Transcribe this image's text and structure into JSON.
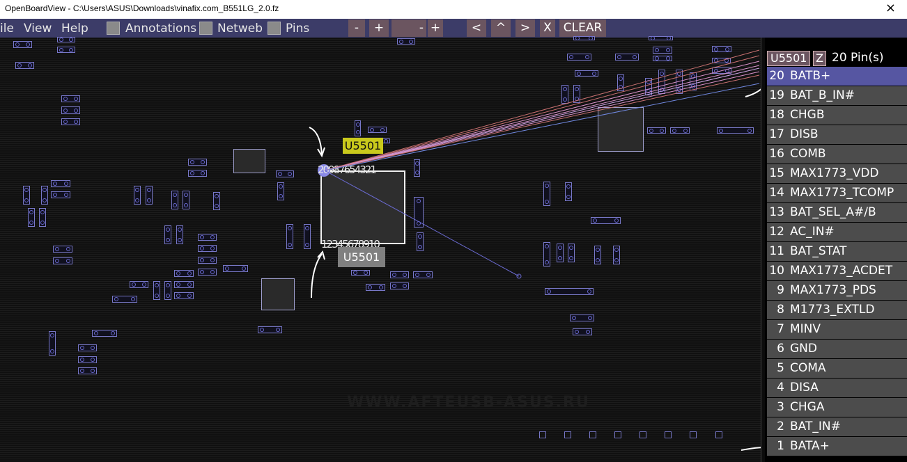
{
  "window": {
    "title": "OpenBoardView - C:\\Users\\ASUS\\Downloads\\vinafix.com_B551LG_2.0.fz",
    "close_glyph": "×"
  },
  "menu": {
    "file": "ile",
    "view": "View",
    "help": "Help"
  },
  "toolbar": {
    "annotations": "Annotations",
    "netweb": "Netweb",
    "pins": "Pins",
    "zoom_out": "-",
    "zoom_in": "+",
    "netweb_minus": "-",
    "netweb_plus": "+",
    "prev": "<",
    "up": "^",
    "next": ">",
    "x": "X",
    "clear": "CLEAR"
  },
  "board": {
    "part_label": "U5501",
    "part_label_bottom": "U5501",
    "top_pins_text": "20987654321",
    "bottom_pins_text": "12345678910",
    "pin20_text": "20",
    "watermark": "WWW.AFTEUSB-ASUS.RU"
  },
  "panel": {
    "part_name": "U5501",
    "z_label": "Z",
    "pin_count": "20 Pin(s)",
    "selected_pin": "20",
    "pins": [
      {
        "num": "20",
        "net": "BATB+"
      },
      {
        "num": "19",
        "net": "BAT_B_IN#"
      },
      {
        "num": "18",
        "net": "CHGB"
      },
      {
        "num": "17",
        "net": "DISB"
      },
      {
        "num": "16",
        "net": "COMB"
      },
      {
        "num": "15",
        "net": "MAX1773_VDD"
      },
      {
        "num": "14",
        "net": "MAX1773_TCOMP"
      },
      {
        "num": "13",
        "net": "BAT_SEL_A#/B"
      },
      {
        "num": "12",
        "net": "AC_IN#"
      },
      {
        "num": "11",
        "net": "BAT_STAT"
      },
      {
        "num": "10",
        "net": "MAX1773_ACDET"
      },
      {
        "num": "9",
        "net": "MAX1773_PDS"
      },
      {
        "num": "8",
        "net": "M1773_EXTLD"
      },
      {
        "num": "7",
        "net": "MINV"
      },
      {
        "num": "6",
        "net": "GND"
      },
      {
        "num": "5",
        "net": "COMA"
      },
      {
        "num": "4",
        "net": "DISA"
      },
      {
        "num": "3",
        "net": "CHGA"
      },
      {
        "num": "2",
        "net": "BAT_IN#"
      },
      {
        "num": "1",
        "net": "BATA+"
      }
    ]
  }
}
